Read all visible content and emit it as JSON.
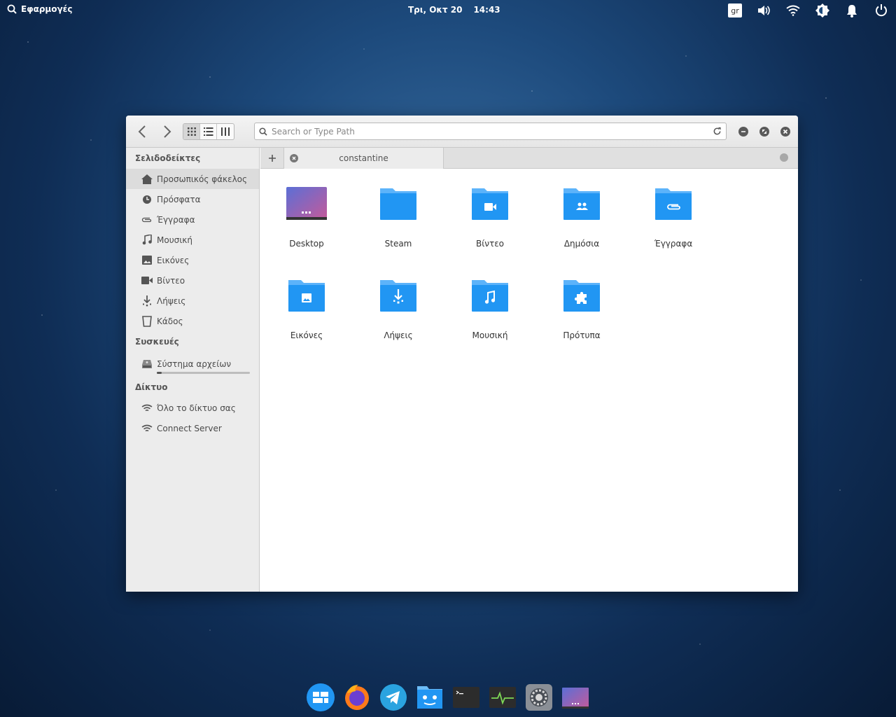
{
  "panel": {
    "applications_label": "Εφαρμογές",
    "date": "Τρι, Οκτ 20",
    "time": "14:43",
    "keyboard_layout": "gr"
  },
  "window": {
    "search": {
      "placeholder": "Search or Type Path"
    },
    "tab": {
      "label": "constantine"
    },
    "sidebar": {
      "bookmarks_title": "Σελιδοδείκτες",
      "bookmarks": [
        {
          "label": "Προσωπικός φάκελος",
          "icon": "home-icon"
        },
        {
          "label": "Πρόσφατα",
          "icon": "recent-icon"
        },
        {
          "label": "Έγγραφα",
          "icon": "paperclip-icon"
        },
        {
          "label": "Μουσική",
          "icon": "music-icon"
        },
        {
          "label": "Εικόνες",
          "icon": "image-icon"
        },
        {
          "label": "Βίντεο",
          "icon": "video-icon"
        },
        {
          "label": "Λήψεις",
          "icon": "download-icon"
        },
        {
          "label": "Κάδος",
          "icon": "trash-icon"
        }
      ],
      "devices_title": "Συσκευές",
      "devices": [
        {
          "label": "Σύστημα αρχείων",
          "icon": "drive-icon",
          "usage": 0.05
        }
      ],
      "network_title": "Δίκτυο",
      "network": [
        {
          "label": "Όλο το δίκτυο σας",
          "icon": "wifi-icon"
        },
        {
          "label": "Connect Server",
          "icon": "wifi-icon"
        }
      ]
    },
    "files": [
      {
        "label": "Desktop",
        "icon": "desktop-folder-icon"
      },
      {
        "label": "Steam",
        "icon": "folder-icon"
      },
      {
        "label": "Βίντεο",
        "icon": "video-folder-icon"
      },
      {
        "label": "Δημόσια",
        "icon": "public-folder-icon"
      },
      {
        "label": "Έγγραφα",
        "icon": "documents-folder-icon"
      },
      {
        "label": "Εικόνες",
        "icon": "pictures-folder-icon"
      },
      {
        "label": "Λήψεις",
        "icon": "downloads-folder-icon"
      },
      {
        "label": "Μουσική",
        "icon": "music-folder-icon"
      },
      {
        "label": "Πρότυπα",
        "icon": "templates-folder-icon"
      }
    ]
  },
  "dock": [
    {
      "name": "multitasking-view-icon"
    },
    {
      "name": "firefox-icon"
    },
    {
      "name": "telegram-icon"
    },
    {
      "name": "files-icon"
    },
    {
      "name": "terminal-icon"
    },
    {
      "name": "system-monitor-icon"
    },
    {
      "name": "settings-icon"
    },
    {
      "name": "show-desktop-icon"
    }
  ],
  "colors": {
    "folder": "#2196f3",
    "folder_light": "#5cb3fa",
    "panel_text": "#ffffff"
  }
}
